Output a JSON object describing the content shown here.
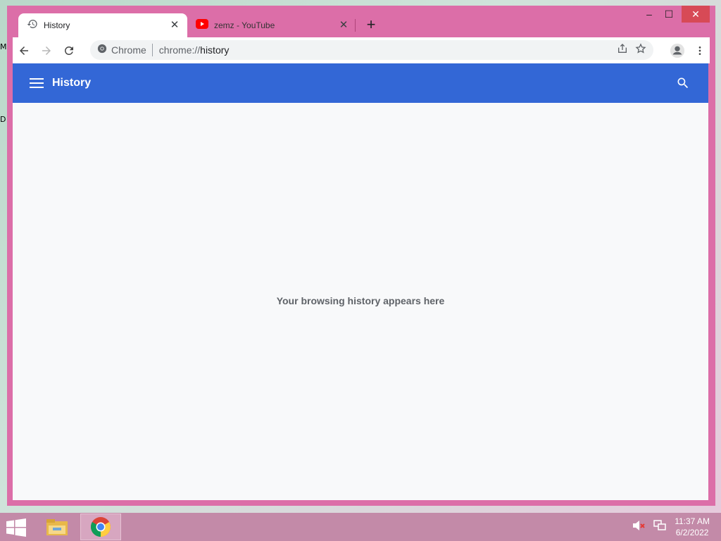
{
  "desktop": {
    "edge_labels": [
      "M",
      "D"
    ]
  },
  "tabs": [
    {
      "title": "History",
      "icon": "history-icon",
      "active": true
    },
    {
      "title": "zemz - YouTube",
      "icon": "youtube-icon",
      "active": false
    }
  ],
  "window_controls": {
    "minimize": "–",
    "maximize": "☐",
    "close": "✕"
  },
  "omnibox": {
    "chip": "Chrome",
    "url_scheme": "chrome://",
    "url_host": "history"
  },
  "history_page": {
    "title": "History",
    "empty_message": "Your browsing history appears here"
  },
  "colors": {
    "header_blue": "#3367d6",
    "window_frame": "#dc6ea8",
    "taskbar": "#c38aa8"
  },
  "taskbar": {
    "items": [
      "file-explorer-icon",
      "chrome-icon"
    ],
    "clock_time": "11:37 AM",
    "clock_date": "6/2/2022"
  }
}
